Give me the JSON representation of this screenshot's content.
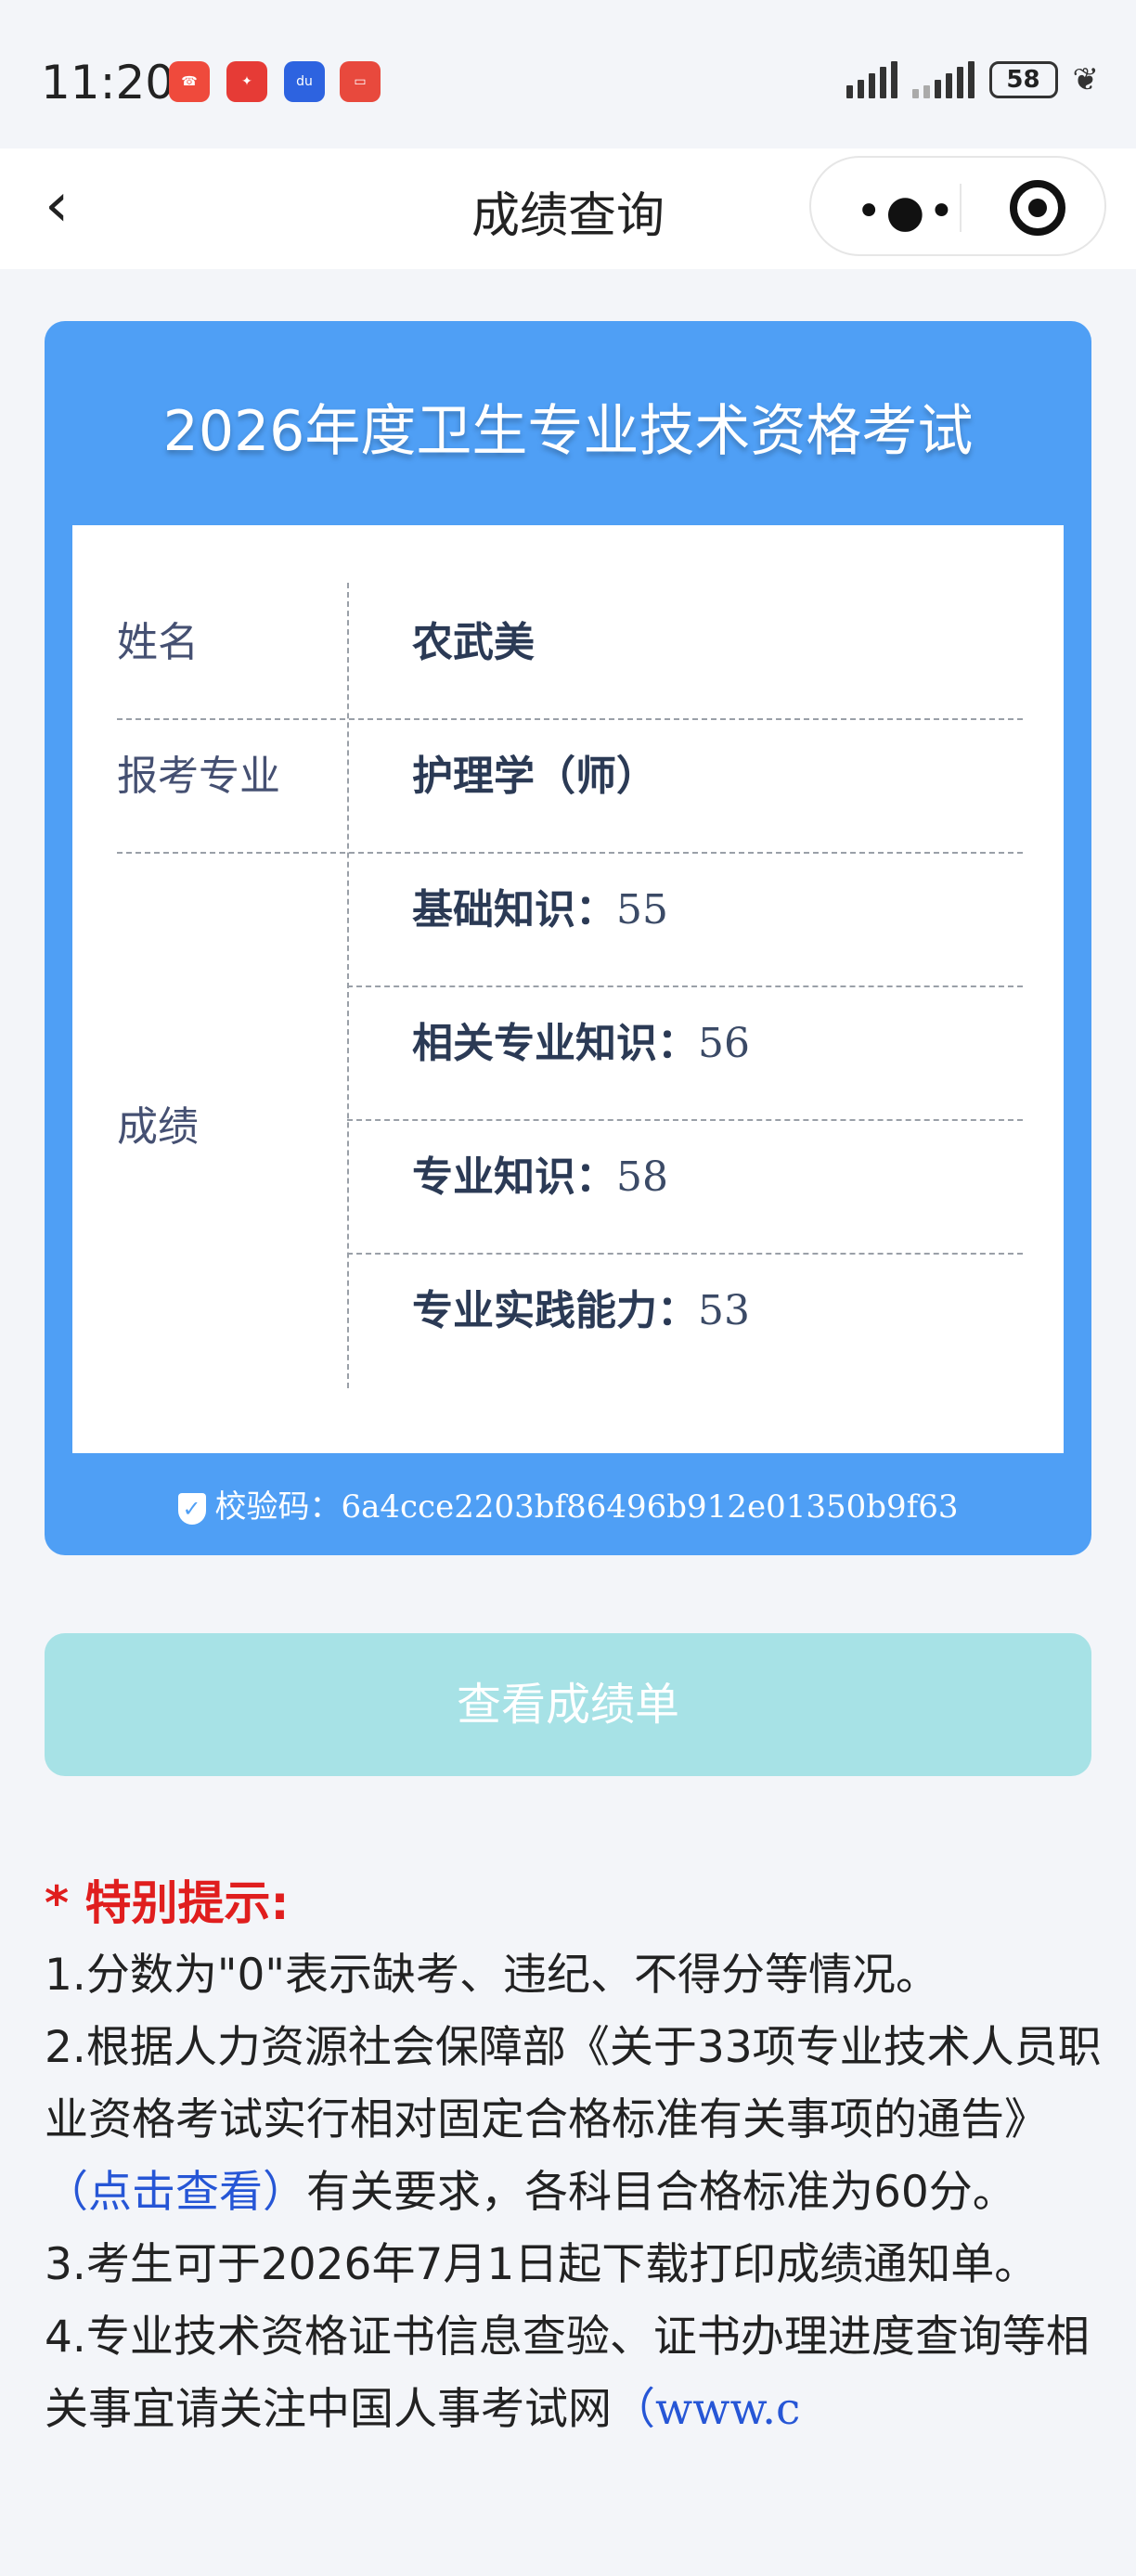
{
  "status_bar": {
    "time": "11:20",
    "app_icons": [
      "phone-missed-icon",
      "huawei-icon",
      "baidu-icon",
      "message-icon"
    ],
    "battery": "58"
  },
  "nav": {
    "title": "成绩查询"
  },
  "card": {
    "title": "2026年度卫生专业技术资格考试",
    "name_label": "姓名",
    "name_value": "农武美",
    "major_label": "报考专业",
    "major_value": "护理学（师）",
    "score_label": "成绩",
    "scores": [
      {
        "subject": "基础知识：",
        "score": "55"
      },
      {
        "subject": "相关专业知识：",
        "score": "56"
      },
      {
        "subject": "专业知识：",
        "score": "58"
      },
      {
        "subject": "专业实践能力：",
        "score": "53"
      }
    ],
    "verify_label": "校验码：",
    "verify_code": "6a4cce2203bf86496b912e01350b9f63"
  },
  "button": {
    "label": "查看成绩单"
  },
  "notice": {
    "heading": "* 特别提示:",
    "item1": "1.分数为\"0\"表示缺考、违纪、不得分等情况。",
    "item2_a": "2.根据人力资源社会保障部《关于33项专业技术人员职业资格考试实行相对固定合格标准有关事项的通告》",
    "item2_link": "（点击查看）",
    "item2_b": "有关要求，各科目合格标准为60分。",
    "item3": "3.考生可于2026年7月1日起下载打印成绩通知单。",
    "item4_a": "4.专业技术资格证书信息查验、证书办理进度查询等相关事宜请关注中国人事考试网",
    "item4_link": "（www.c"
  }
}
